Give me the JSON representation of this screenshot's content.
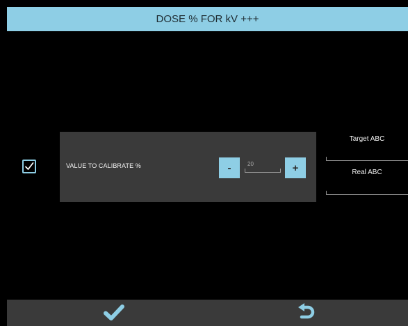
{
  "header": {
    "title": "DOSE % FOR kV +++"
  },
  "calibration": {
    "checkbox_icon": "checkmark-checkbox-icon",
    "checked": true,
    "label": "VALUE TO CALIBRATE %",
    "minus_label": "-",
    "plus_label": "+",
    "value": "20"
  },
  "side_panel": {
    "target_label": "Target ABC",
    "real_label": "Real ABC"
  },
  "footer": {
    "confirm_icon": "checkmark-icon",
    "back_icon": "undo-arrow-icon"
  },
  "colors": {
    "accent": "#8ecee5",
    "background": "#000000",
    "panel": "#3a3a3a",
    "text": "#ffffff"
  }
}
